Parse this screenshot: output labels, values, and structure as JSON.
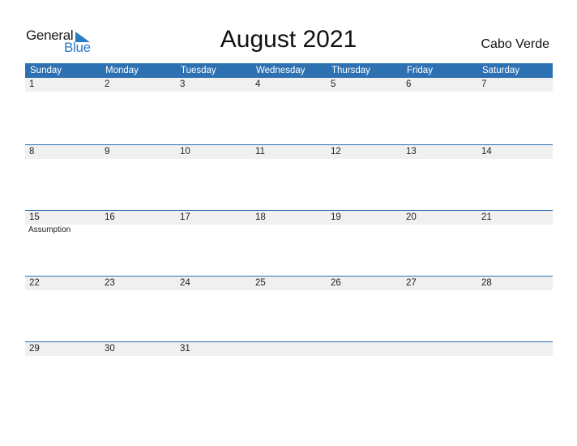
{
  "logo": {
    "word1": "General",
    "word2": "Blue"
  },
  "title": "August 2021",
  "country": "Cabo Verde",
  "colors": {
    "header_bg": "#2e71b3",
    "accent": "#2a7bc4",
    "date_strip": "#f0f0f0"
  },
  "weekdays": [
    "Sunday",
    "Monday",
    "Tuesday",
    "Wednesday",
    "Thursday",
    "Friday",
    "Saturday"
  ],
  "weeks": [
    {
      "days": [
        "1",
        "2",
        "3",
        "4",
        "5",
        "6",
        "7"
      ],
      "events": [
        "",
        "",
        "",
        "",
        "",
        "",
        ""
      ]
    },
    {
      "days": [
        "8",
        "9",
        "10",
        "11",
        "12",
        "13",
        "14"
      ],
      "events": [
        "",
        "",
        "",
        "",
        "",
        "",
        ""
      ]
    },
    {
      "days": [
        "15",
        "16",
        "17",
        "18",
        "19",
        "20",
        "21"
      ],
      "events": [
        "Assumption",
        "",
        "",
        "",
        "",
        "",
        ""
      ]
    },
    {
      "days": [
        "22",
        "23",
        "24",
        "25",
        "26",
        "27",
        "28"
      ],
      "events": [
        "",
        "",
        "",
        "",
        "",
        "",
        ""
      ]
    },
    {
      "days": [
        "29",
        "30",
        "31",
        "",
        "",
        "",
        ""
      ],
      "events": [
        "",
        "",
        "",
        "",
        "",
        "",
        ""
      ]
    }
  ]
}
